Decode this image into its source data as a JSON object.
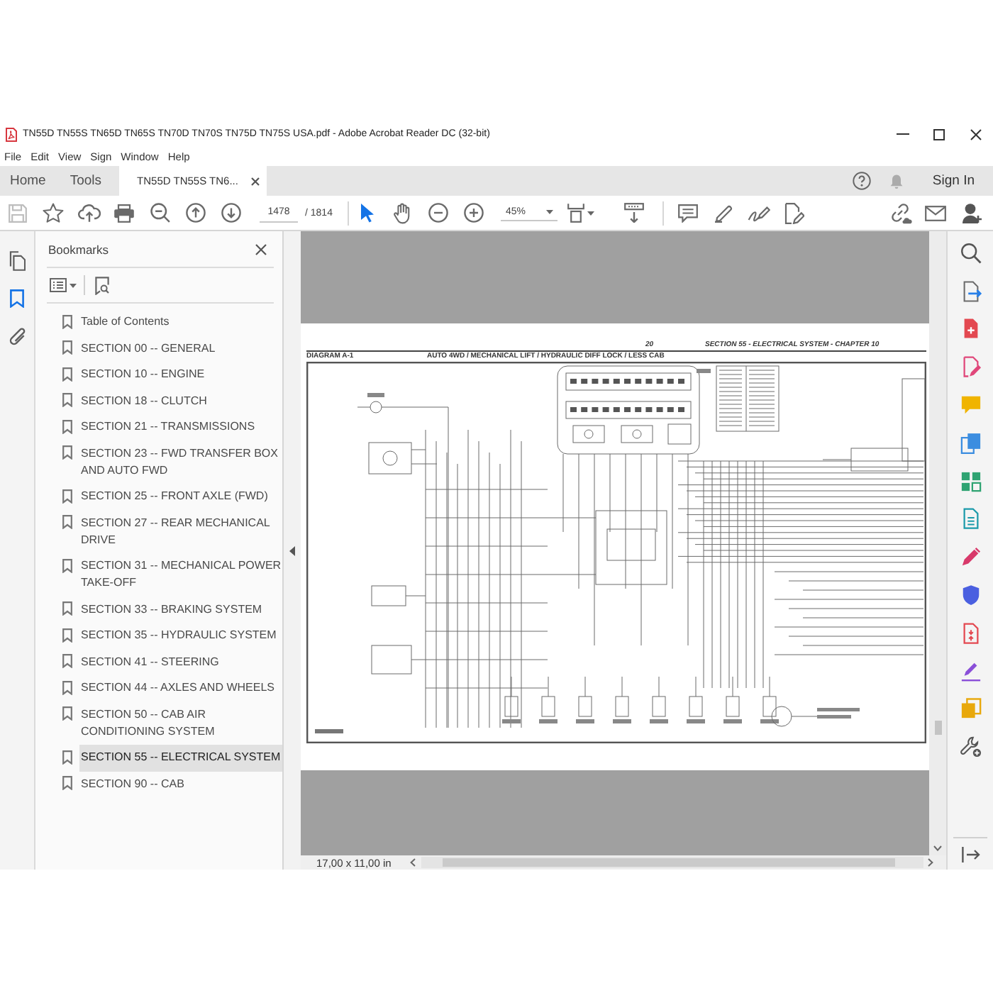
{
  "window": {
    "title": "TN55D TN55S TN65D TN65S TN70D TN70S TN75D TN75S USA.pdf - Adobe Acrobat Reader DC (32-bit)"
  },
  "menu": [
    "File",
    "Edit",
    "View",
    "Sign",
    "Window",
    "Help"
  ],
  "tabs": [
    {
      "label": "Home",
      "selected": false,
      "closable": false
    },
    {
      "label": "Tools",
      "selected": false,
      "closable": false
    },
    {
      "label": "TN55D TN55S TN6...",
      "selected": true,
      "closable": true
    }
  ],
  "account": {
    "sign_in": "Sign In"
  },
  "toolbar": {
    "save_disabled": true,
    "page_current": "1478",
    "page_total": "/ 1814",
    "pointer_tool_selected": true,
    "zoom": "45%"
  },
  "nav_panels": [
    {
      "kind": "pages",
      "selected": false
    },
    {
      "kind": "bookmarks",
      "selected": true
    },
    {
      "kind": "attachments",
      "selected": false
    }
  ],
  "sidebar": {
    "title": "Bookmarks",
    "items": [
      {
        "label": "Table of Contents",
        "selected": false
      },
      {
        "label": "SECTION 00 -- GENERAL",
        "selected": false
      },
      {
        "label": "SECTION 10 -- ENGINE",
        "selected": false
      },
      {
        "label": "SECTION 18 -- CLUTCH",
        "selected": false
      },
      {
        "label": "SECTION 21 -- TRANSMISSIONS",
        "selected": false
      },
      {
        "label": "SECTION 23 -- FWD TRANSFER BOX AND AUTO FWD",
        "selected": false
      },
      {
        "label": "SECTION 25 -- FRONT AXLE (FWD)",
        "selected": false
      },
      {
        "label": "SECTION 27 -- REAR MECHANICAL DRIVE",
        "selected": false
      },
      {
        "label": "SECTION 31 -- MECHANICAL POWER TAKE-OFF",
        "selected": false
      },
      {
        "label": "SECTION 33 -- BRAKING SYSTEM",
        "selected": false
      },
      {
        "label": "SECTION 35 -- HYDRAULIC SYSTEM",
        "selected": false
      },
      {
        "label": "SECTION 41 -- STEERING",
        "selected": false
      },
      {
        "label": "SECTION 44 -- AXLES AND WHEELS",
        "selected": false
      },
      {
        "label": "SECTION 50 -- CAB AIR CONDITIONING SYSTEM",
        "selected": false
      },
      {
        "label": "SECTION 55 -- ELECTRICAL SYSTEM",
        "selected": true
      },
      {
        "label": "SECTION 90 -- CAB",
        "selected": false
      }
    ]
  },
  "document": {
    "page_number": "20",
    "section_title": "SECTION 55 - ELECTRICAL SYSTEM - CHAPTER 10",
    "diagram_label": "DIAGRAM A-1",
    "diagram_title": "AUTO 4WD / MECHANICAL LIFT / HYDRAULIC DIFF LOCK / LESS CAB"
  },
  "status_bar": {
    "page_size": "17,00 x 11,00 in"
  }
}
